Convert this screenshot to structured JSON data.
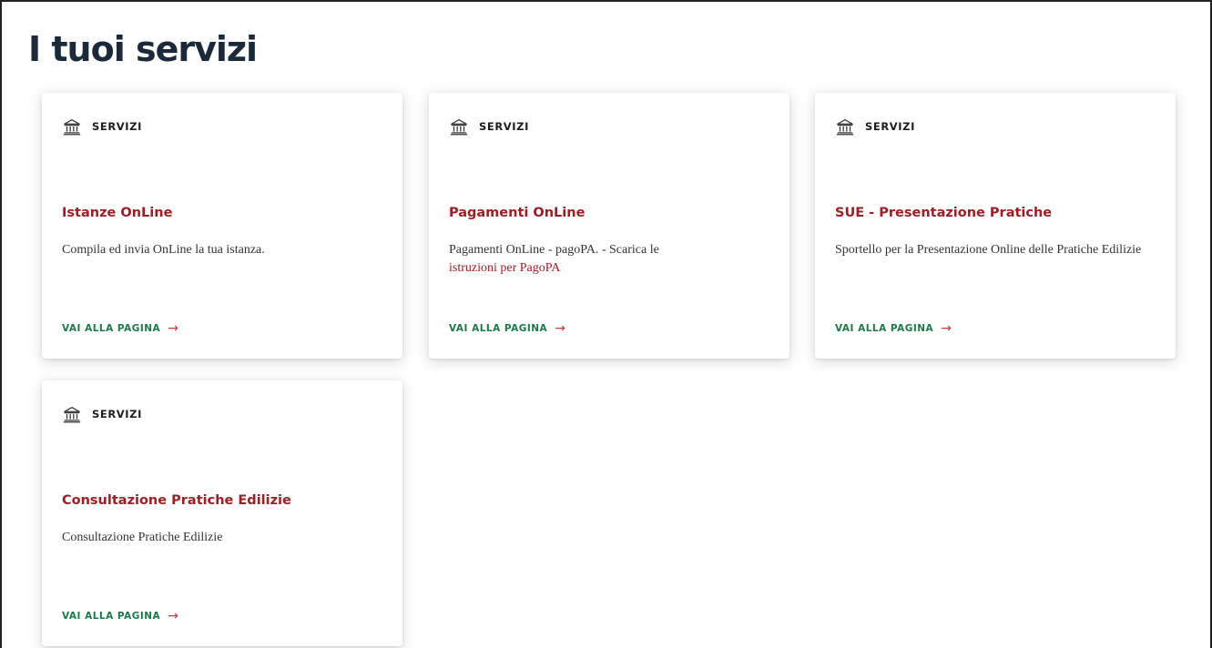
{
  "page": {
    "title": "I tuoi servizi"
  },
  "colors": {
    "title": "#1b2a3b",
    "card_title": "#a21c24",
    "link": "#1b7a4a",
    "arrow": "#c23b48"
  },
  "cards": [
    {
      "category": "SERVIZI",
      "category_icon": "bank-icon",
      "title": "Istanze OnLine",
      "description": "Compila ed invia OnLine la tua istanza.",
      "link_label": "VAI ALLA PAGINA",
      "arrow": "→"
    },
    {
      "category": "SERVIZI",
      "category_icon": "bank-icon",
      "title": "Pagamenti OnLine",
      "description": "Pagamenti OnLine - pagoPA. - Scarica le",
      "description_link": "istruzioni per PagoPA",
      "link_label": "VAI ALLA PAGINA",
      "arrow": "→"
    },
    {
      "category": "SERVIZI",
      "category_icon": "bank-icon",
      "title": "SUE - Presentazione Pratiche",
      "description": "Sportello per la Presentazione Online delle Pratiche Edilizie",
      "link_label": "VAI ALLA PAGINA",
      "arrow": "→"
    },
    {
      "category": "SERVIZI",
      "category_icon": "bank-icon",
      "title": "Consultazione Pratiche Edilizie",
      "description": "Consultazione Pratiche Edilizie",
      "link_label": "VAI ALLA PAGINA",
      "arrow": "→"
    }
  ]
}
